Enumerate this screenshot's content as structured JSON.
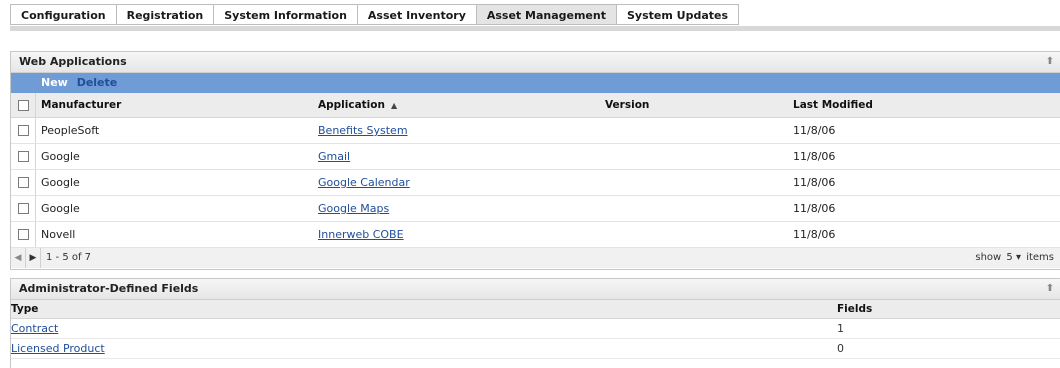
{
  "tabs": [
    {
      "label": "Configuration",
      "active": false
    },
    {
      "label": "Registration",
      "active": false
    },
    {
      "label": "System Information",
      "active": false
    },
    {
      "label": "Asset Inventory",
      "active": false
    },
    {
      "label": "Asset Management",
      "active": true
    },
    {
      "label": "System Updates",
      "active": false
    }
  ],
  "web_apps": {
    "title": "Web Applications",
    "toolbar": {
      "new_label": "New",
      "delete_label": "Delete"
    },
    "columns": {
      "manufacturer": "Manufacturer",
      "application": "Application",
      "version": "Version",
      "last_modified": "Last Modified"
    },
    "rows": [
      {
        "manufacturer": "PeopleSoft",
        "application": "Benefits System",
        "version": "",
        "last_modified": "11/8/06"
      },
      {
        "manufacturer": "Google",
        "application": "Gmail",
        "version": "",
        "last_modified": "11/8/06"
      },
      {
        "manufacturer": "Google",
        "application": "Google Calendar",
        "version": "",
        "last_modified": "11/8/06"
      },
      {
        "manufacturer": "Google",
        "application": "Google Maps",
        "version": "",
        "last_modified": "11/8/06"
      },
      {
        "manufacturer": "Novell",
        "application": "Innerweb COBE",
        "version": "",
        "last_modified": "11/8/06"
      }
    ],
    "footer": {
      "range": "1 - 5 of 7",
      "show_label": "show",
      "show_value": "5",
      "items_label": "items"
    }
  },
  "adf": {
    "title": "Administrator-Defined Fields",
    "columns": {
      "type": "Type",
      "fields": "Fields"
    },
    "rows": [
      {
        "type": "Contract",
        "fields": "1"
      },
      {
        "type": "Licensed Product",
        "fields": "0"
      }
    ]
  }
}
